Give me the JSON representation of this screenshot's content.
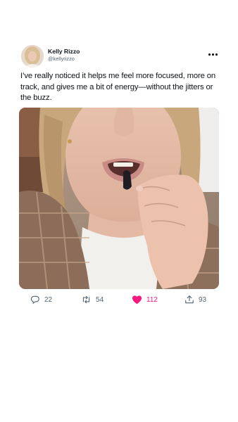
{
  "post": {
    "author": {
      "display_name": "Kelly Rizzo",
      "handle": "@kellyrizzo"
    },
    "text": "I’ve really noticed it helps me feel more focused, more on track, and gives me a bit of energy—without the jitters or the buzz.",
    "media_alt": "Woman eating a small dark gummy",
    "actions": {
      "replies": "22",
      "reposts": "54",
      "likes": "112",
      "shares": "93"
    }
  },
  "icons": {
    "more": "more-horizontal-icon",
    "reply": "reply-icon",
    "repost": "repost-icon",
    "like": "heart-filled-icon",
    "share": "share-icon"
  },
  "colors": {
    "like_active": "#f91880",
    "secondary_text": "#536471",
    "primary_text": "#0f1419"
  }
}
